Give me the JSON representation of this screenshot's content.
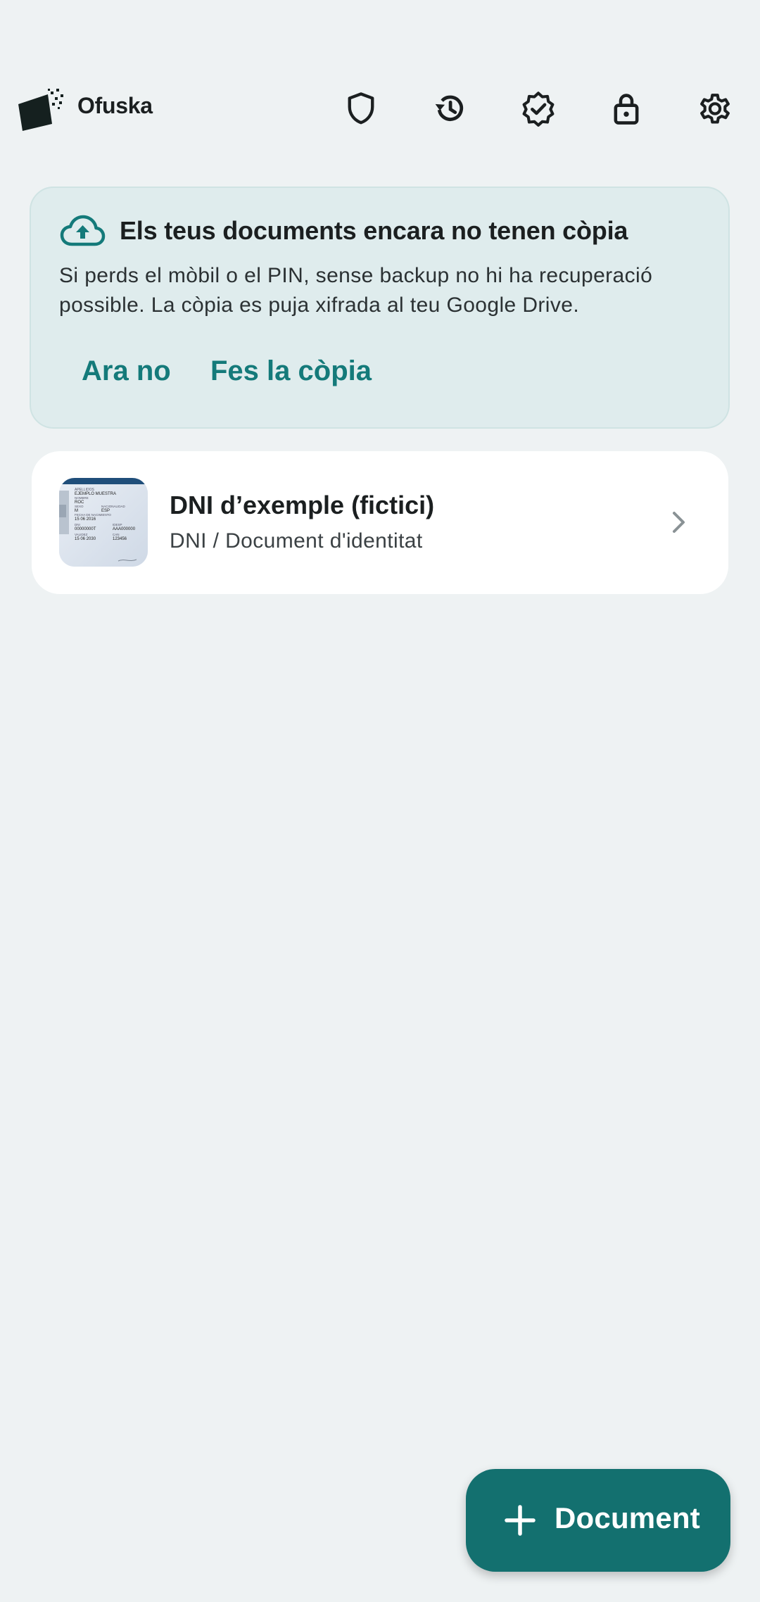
{
  "app": {
    "title": "Ofuska"
  },
  "toolbar": {
    "actions": [
      {
        "icon": "shield-icon"
      },
      {
        "icon": "history-icon"
      },
      {
        "icon": "verified-badge-icon"
      },
      {
        "icon": "lock-icon"
      },
      {
        "icon": "gear-icon"
      }
    ]
  },
  "banner": {
    "icon": "cloud-upload-icon",
    "title": "Els teus documents encara no tenen còpia",
    "body": "Si perds el mòbil o el PIN, sense backup no hi ha recuperació possible. La còpia es puja xifrada al teu Google Drive.",
    "dismiss_label": "Ara no",
    "backup_label": "Fes la còpia"
  },
  "documents": [
    {
      "title": "DNI d’exemple (fictici)",
      "subtitle": "DNI / Document d'identitat",
      "thumbnail": {
        "name_label": "EJEMPLO MUESTRA",
        "given_label": "ROC",
        "sex": "M",
        "nationality": "ESP",
        "birth_date": "15 06 2016",
        "doc_number": "00000000T",
        "support_number": "AAA000000",
        "expiry": "15 06 2030",
        "can": "123456"
      }
    }
  ],
  "fab": {
    "icon": "plus-icon",
    "label": "Document"
  },
  "colors": {
    "background": "#eef2f3",
    "accent": "#147a7a",
    "banner_bg": "#dfeced",
    "fab_bg": "#13706f"
  }
}
